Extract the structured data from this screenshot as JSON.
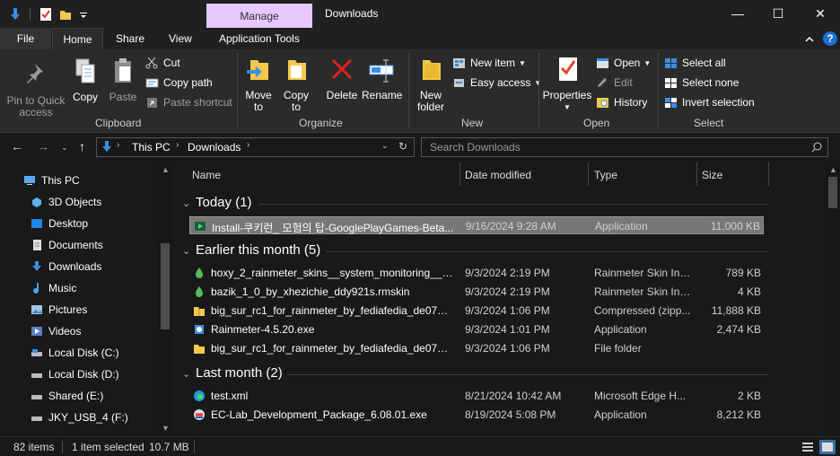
{
  "window": {
    "title": "Downloads",
    "context_tab": "Manage",
    "controls": {
      "minimize": "—",
      "maximize": "☐",
      "close": "✕"
    },
    "quick_access_toolbar": [
      "down-arrow-icon",
      "properties-icon",
      "folder-icon",
      "dropdown-icon"
    ]
  },
  "tabs": {
    "file": "File",
    "home": "Home",
    "share": "Share",
    "view": "View",
    "app_tools": "Application Tools",
    "active": "Home"
  },
  "ribbon": {
    "clipboard": {
      "label": "Clipboard",
      "pin": "Pin to Quick access",
      "pin_line1": "Pin to Quick",
      "pin_line2": "access",
      "copy": "Copy",
      "paste": "Paste",
      "cut": "Cut",
      "copy_path": "Copy path",
      "paste_shortcut": "Paste shortcut"
    },
    "organize": {
      "label": "Organize",
      "move_to": "Move to",
      "move_l1": "Move",
      "move_l2": "to",
      "copy_to": "Copy to",
      "copy_l1": "Copy",
      "copy_l2": "to",
      "delete": "Delete",
      "rename": "Rename"
    },
    "new": {
      "label": "New",
      "new_folder_l1": "New",
      "new_folder_l2": "folder",
      "new_item": "New item",
      "easy_access": "Easy access"
    },
    "open": {
      "label": "Open",
      "properties": "Properties",
      "open": "Open",
      "edit": "Edit",
      "history": "History"
    },
    "select": {
      "label": "Select",
      "select_all": "Select all",
      "select_none": "Select none",
      "invert": "Invert selection"
    }
  },
  "address": {
    "crumbs": [
      "This PC",
      "Downloads"
    ],
    "search_placeholder": "Search Downloads"
  },
  "sidebar": {
    "items": [
      {
        "label": "This PC",
        "icon": "pc-icon"
      },
      {
        "label": "3D Objects",
        "icon": "cube-icon"
      },
      {
        "label": "Desktop",
        "icon": "desktop-icon"
      },
      {
        "label": "Documents",
        "icon": "document-icon"
      },
      {
        "label": "Downloads",
        "icon": "download-icon"
      },
      {
        "label": "Music",
        "icon": "music-icon"
      },
      {
        "label": "Pictures",
        "icon": "picture-icon"
      },
      {
        "label": "Videos",
        "icon": "video-icon"
      },
      {
        "label": "Local Disk (C:)",
        "icon": "drive-icon"
      },
      {
        "label": "Local Disk (D:)",
        "icon": "drive-icon"
      },
      {
        "label": "Shared (E:)",
        "icon": "drive-icon"
      },
      {
        "label": "JKY_USB_4 (F:)",
        "icon": "usb-drive-icon"
      }
    ]
  },
  "columns": {
    "name": "Name",
    "date": "Date modified",
    "type": "Type",
    "size": "Size"
  },
  "groups": {
    "today": "Today (1)",
    "earlier": "Earlier this month (5)",
    "last_month": "Last month (2)"
  },
  "files": {
    "today": [
      {
        "name": "Install-쿠키런_ 모험의 탑-GooglePlayGames-Beta...",
        "date": "9/16/2024 9:28 AM",
        "type": "Application",
        "size": "11,000 KB",
        "icon": "google-play-icon",
        "selected": true
      }
    ],
    "earlier": [
      {
        "name": "hoxy_2_rainmeter_skins__system_monitoring__by...",
        "date": "9/3/2024 2:19 PM",
        "type": "Rainmeter Skin Ins...",
        "size": "789 KB",
        "icon": "rainmeter-drop-icon"
      },
      {
        "name": "bazik_1_0_by_xhezichie_ddy921s.rmskin",
        "date": "9/3/2024 2:19 PM",
        "type": "Rainmeter Skin Ins...",
        "size": "4 KB",
        "icon": "rainmeter-drop-icon"
      },
      {
        "name": "big_sur_rc1_for_rainmeter_by_fediafedia_de07mo...",
        "date": "9/3/2024 1:06 PM",
        "type": "Compressed (zipp...",
        "size": "11,888 KB",
        "icon": "zip-folder-icon"
      },
      {
        "name": "Rainmeter-4.5.20.exe",
        "date": "9/3/2024 1:01 PM",
        "type": "Application",
        "size": "2,474 KB",
        "icon": "installer-icon"
      },
      {
        "name": "big_sur_rc1_for_rainmeter_by_fediafedia_de07mou",
        "date": "9/3/2024 1:06 PM",
        "type": "File folder",
        "size": "",
        "icon": "folder-icon"
      }
    ],
    "last_month": [
      {
        "name": "test.xml",
        "date": "8/21/2024 10:42 AM",
        "type": "Microsoft Edge H...",
        "size": "2 KB",
        "icon": "edge-icon"
      },
      {
        "name": "EC-Lab_Development_Package_6.08.01.exe",
        "date": "8/19/2024 5:08 PM",
        "type": "Application",
        "size": "8,212 KB",
        "icon": "exe-icon"
      }
    ]
  },
  "status": {
    "items": "82 items",
    "selected": "1 item selected",
    "size": "10.7 MB"
  }
}
